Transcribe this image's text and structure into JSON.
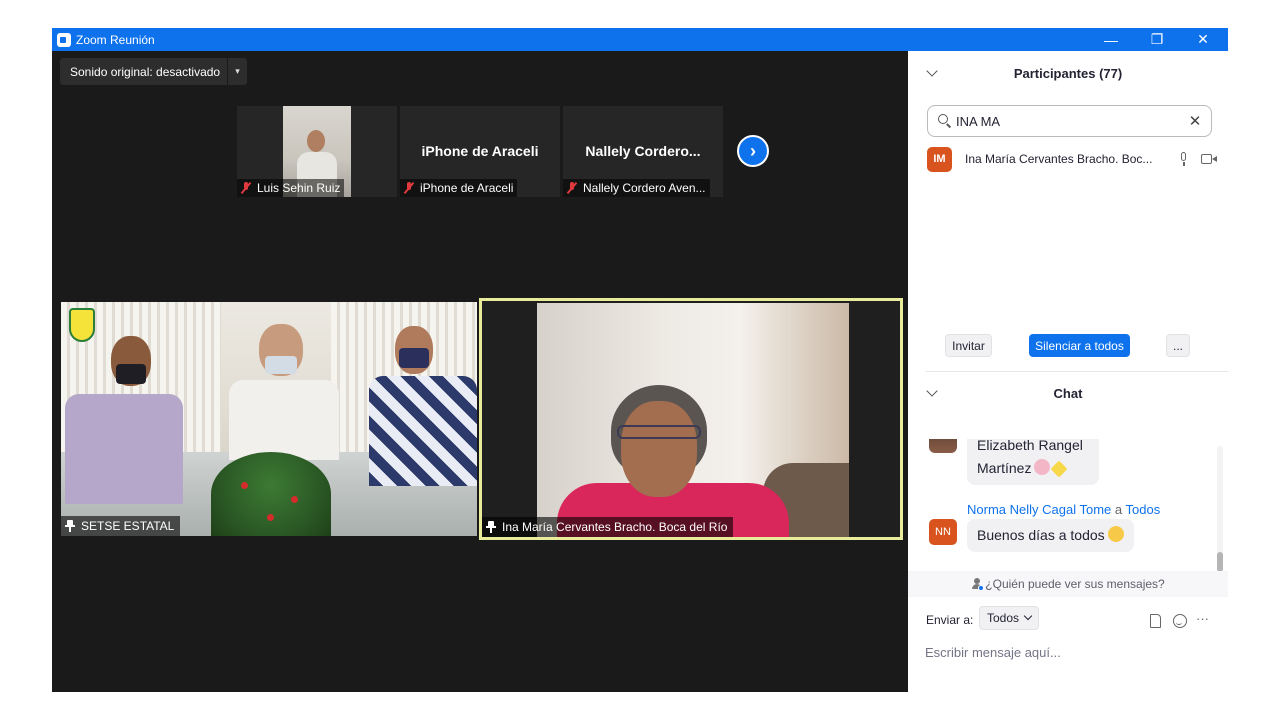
{
  "window": {
    "title": "Zoom Reunión",
    "minimize": "—",
    "maximize": "❐",
    "close": "✕"
  },
  "video": {
    "sound_button": "Sonido original: desactivado",
    "sound_caret": "▾",
    "next_arrow": "›",
    "thumbnails": [
      {
        "label": "Luis Sehin Ruiz",
        "big_name": "",
        "muted": true
      },
      {
        "label": "iPhone de Araceli",
        "big_name": "iPhone de Araceli",
        "muted": true
      },
      {
        "label": "Nallely Cordero Aven...",
        "big_name": "Nallely  Cordero...",
        "muted": true
      }
    ],
    "main_tiles": [
      {
        "label": "SETSE ESTATAL",
        "pinned": true
      },
      {
        "label": "Ina María Cervantes Bracho. Boca del Río",
        "pinned": true,
        "active_speaker": true,
        "highlight_color": "#e8ec9a"
      }
    ]
  },
  "participants": {
    "header": "Participantes (77)",
    "search_value": "INA MA",
    "search_clear": "✕",
    "items": [
      {
        "initials": "IM",
        "name": "Ina María Cervantes Bracho. Boc...",
        "avatar_color": "#d9531e"
      }
    ],
    "buttons": {
      "invite": "Invitar",
      "mute_all": "Silenciar a todos",
      "more": "..."
    }
  },
  "chat": {
    "header": "Chat",
    "messages": [
      {
        "text_line1": "Elizabeth Rangel",
        "text_line2": "Martínez"
      },
      {
        "sender": "Norma Nelly Cagal Tome",
        "to_word": "a",
        "recipient": "Todos",
        "initials": "NN",
        "text": "Buenos días a todos"
      }
    ],
    "who_can_see": "¿Quién puede ver sus mensajes?",
    "send_to_label": "Enviar a:",
    "send_to_value": "Todos",
    "more": "···",
    "compose_placeholder": "Escribir mensaje aquí..."
  },
  "colors": {
    "zoom_blue": "#0e72ed",
    "avatar_orange": "#d9531e",
    "active_speaker_border": "#e8ec9a"
  }
}
